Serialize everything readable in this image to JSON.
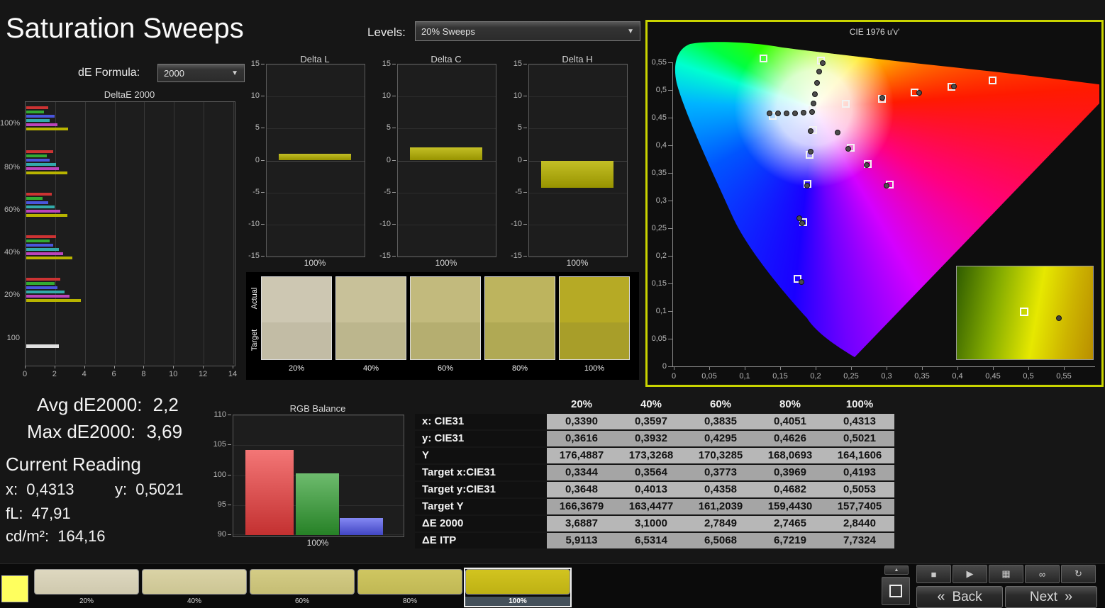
{
  "header": {
    "title": "Saturation Sweeps",
    "levels_label": "Levels:",
    "levels_value": "20% Sweeps",
    "de_formula_label": "dE Formula:",
    "de_formula_value": "2000"
  },
  "accent": {
    "cie_border": "#c9d400"
  },
  "chart_data": [
    {
      "type": "bar",
      "orientation": "horizontal",
      "title": "DeltaE 2000",
      "xlim": [
        0,
        14
      ],
      "xticks": [
        0,
        2,
        4,
        6,
        8,
        10,
        12,
        14
      ],
      "group_colors": [
        "#cc3333",
        "#33aa33",
        "#4a55dd",
        "#33aaaa",
        "#bb44bb",
        "#b8b400"
      ],
      "groups": [
        {
          "label": "100%",
          "values": [
            1.5,
            1.2,
            1.9,
            1.6,
            2.1,
            2.84
          ]
        },
        {
          "label": "80%",
          "values": [
            1.8,
            1.4,
            1.6,
            2.0,
            2.2,
            2.75
          ]
        },
        {
          "label": "60%",
          "values": [
            1.7,
            1.1,
            1.5,
            1.9,
            2.3,
            2.78
          ]
        },
        {
          "label": "40%",
          "values": [
            2.0,
            1.6,
            1.8,
            2.2,
            2.5,
            3.1
          ]
        },
        {
          "label": "20%",
          "values": [
            2.3,
            1.9,
            2.1,
            2.6,
            2.9,
            3.69
          ]
        },
        {
          "label": "100",
          "values": [
            2.2
          ],
          "colors": [
            "#e0e0e0"
          ]
        }
      ]
    },
    {
      "type": "bar",
      "title": "Delta L",
      "ylim": [
        -15,
        15
      ],
      "yticks": [
        15,
        10,
        5,
        0,
        -5,
        -10,
        -15
      ],
      "xlabel": "100%",
      "value": 1.0,
      "bar_color": "#b9b400"
    },
    {
      "type": "bar",
      "title": "Delta C",
      "ylim": [
        -15,
        15
      ],
      "yticks": [
        15,
        10,
        5,
        0,
        -5,
        -10,
        -15
      ],
      "xlabel": "100%",
      "value": 2.0,
      "bar_color": "#b9b400"
    },
    {
      "type": "bar",
      "title": "Delta H",
      "ylim": [
        -15,
        15
      ],
      "yticks": [
        15,
        10,
        5,
        0,
        -5,
        -10,
        -15
      ],
      "xlabel": "100%",
      "value": -4.3,
      "bar_color": "#b9b400"
    },
    {
      "type": "bar",
      "title": "RGB Balance",
      "ylim": [
        90,
        110
      ],
      "yticks": [
        110,
        105,
        100,
        95,
        90
      ],
      "xlabel": "100%",
      "series": [
        {
          "name": "red",
          "value": 104.2,
          "color": "#ee3b3b"
        },
        {
          "name": "green",
          "value": 100.3,
          "color": "#2f9e2f"
        },
        {
          "name": "blue",
          "value": 92.8,
          "color": "#4f55ee"
        }
      ]
    },
    {
      "type": "scatter",
      "title": "CIE 1976 u'v'",
      "xtick_labels": [
        "0",
        "0,05",
        "0,1",
        "0,15",
        "0,2",
        "0,25",
        "0,3",
        "0,35",
        "0,4",
        "0,45",
        "0,5",
        "0,55"
      ],
      "xtick_values": [
        0,
        0.05,
        0.1,
        0.15,
        0.2,
        0.25,
        0.3,
        0.35,
        0.4,
        0.45,
        0.5,
        0.55
      ],
      "ytick_labels": [
        "0,55",
        "0,5",
        "0,45",
        "0,4",
        "0,35",
        "0,3",
        "0,25",
        "0,2",
        "0,15",
        "0,1",
        "0,05",
        "0"
      ],
      "ytick_values": [
        0.55,
        0.5,
        0.45,
        0.4,
        0.35,
        0.3,
        0.25,
        0.2,
        0.15,
        0.1,
        0.05,
        0
      ],
      "targets": [
        [
          0.126,
          0.558
        ],
        [
          0.207,
          0.554
        ],
        [
          0.449,
          0.518
        ],
        [
          0.391,
          0.506
        ],
        [
          0.339,
          0.496
        ],
        [
          0.293,
          0.485
        ],
        [
          0.242,
          0.476
        ],
        [
          0.195,
          0.464
        ],
        [
          0.139,
          0.454
        ],
        [
          0.196,
          0.428
        ],
        [
          0.249,
          0.396
        ],
        [
          0.191,
          0.383
        ],
        [
          0.273,
          0.367
        ],
        [
          0.188,
          0.331
        ],
        [
          0.304,
          0.329
        ],
        [
          0.182,
          0.262
        ],
        [
          0.174,
          0.159
        ]
      ],
      "measurements": [
        [
          0.21,
          0.549
        ],
        [
          0.205,
          0.533
        ],
        [
          0.202,
          0.513
        ],
        [
          0.199,
          0.492
        ],
        [
          0.197,
          0.476
        ],
        [
          0.294,
          0.486
        ],
        [
          0.346,
          0.495
        ],
        [
          0.395,
          0.506
        ],
        [
          0.135,
          0.458
        ],
        [
          0.147,
          0.458
        ],
        [
          0.159,
          0.458
        ],
        [
          0.171,
          0.458
        ],
        [
          0.183,
          0.459
        ],
        [
          0.195,
          0.46
        ],
        [
          0.193,
          0.426
        ],
        [
          0.231,
          0.423
        ],
        [
          0.193,
          0.388
        ],
        [
          0.246,
          0.394
        ],
        [
          0.272,
          0.364
        ],
        [
          0.3,
          0.327
        ],
        [
          0.188,
          0.327
        ],
        [
          0.177,
          0.268
        ],
        [
          0.181,
          0.259
        ],
        [
          0.18,
          0.152
        ]
      ]
    }
  ],
  "swatch_strip": {
    "row_labels": [
      "Actual",
      "Target"
    ],
    "columns": [
      {
        "label": "20%",
        "actual": "#cdc7b2",
        "target": "#c2bca5"
      },
      {
        "label": "40%",
        "actual": "#c8c199",
        "target": "#bcb68d"
      },
      {
        "label": "60%",
        "actual": "#c2ba7d",
        "target": "#b5ae70"
      },
      {
        "label": "80%",
        "actual": "#bdb45e",
        "target": "#b0a954"
      },
      {
        "label": "100%",
        "actual": "#b6aa25",
        "target": "#a89e29"
      }
    ]
  },
  "summary": {
    "avg_label": "Avg dE2000:",
    "avg_value": "2,2",
    "max_label": "Max dE2000:",
    "max_value": "3,69"
  },
  "current_reading": {
    "heading": "Current Reading",
    "x_label": "x:",
    "x_value": "0,4313",
    "y_label": "y:",
    "y_value": "0,5021",
    "fl_label": "fL:",
    "fl_value": "47,91",
    "cd_label": "cd/m²:",
    "cd_value": "164,16"
  },
  "table": {
    "col_headers": [
      "",
      "20%",
      "40%",
      "60%",
      "80%",
      "100%"
    ],
    "rows": [
      {
        "label": "x: CIE31",
        "values": [
          "0,3390",
          "0,3597",
          "0,3835",
          "0,4051",
          "0,4313"
        ]
      },
      {
        "label": "y: CIE31",
        "values": [
          "0,3616",
          "0,3932",
          "0,4295",
          "0,4626",
          "0,5021"
        ]
      },
      {
        "label": "Y",
        "values": [
          "176,4887",
          "173,3268",
          "170,3285",
          "168,0693",
          "164,1606"
        ]
      },
      {
        "label": "Target x:CIE31",
        "values": [
          "0,3344",
          "0,3564",
          "0,3773",
          "0,3969",
          "0,4193"
        ]
      },
      {
        "label": "Target y:CIE31",
        "values": [
          "0,3648",
          "0,4013",
          "0,4358",
          "0,4682",
          "0,5053"
        ]
      },
      {
        "label": "Target Y",
        "values": [
          "166,3679",
          "163,4477",
          "161,2039",
          "159,4430",
          "157,7405"
        ]
      },
      {
        "label": "ΔE 2000",
        "values": [
          "3,6887",
          "3,1000",
          "2,7849",
          "2,7465",
          "2,8440"
        ]
      },
      {
        "label": "ΔE ITP",
        "values": [
          "5,9113",
          "6,5314",
          "6,5068",
          "6,7219",
          "7,7324"
        ]
      }
    ]
  },
  "bottom_bar": {
    "patch_color": "#ffff5e",
    "swatches": [
      {
        "label": "20%",
        "top": "#ded8c0",
        "bottom": "#cfc9ae",
        "active": false
      },
      {
        "label": "40%",
        "top": "#dad3a6",
        "bottom": "#ccc593",
        "active": false
      },
      {
        "label": "60%",
        "top": "#d4cc86",
        "bottom": "#c5bd74",
        "active": false
      },
      {
        "label": "80%",
        "top": "#cfc661",
        "bottom": "#c0b854",
        "active": false
      },
      {
        "label": "100%",
        "top": "#d2c41f",
        "bottom": "#beb114",
        "active": true
      }
    ],
    "transport": [
      {
        "name": "stop",
        "glyph": "■"
      },
      {
        "name": "play",
        "glyph": "▶"
      },
      {
        "name": "pattern",
        "glyph": "▦"
      },
      {
        "name": "loop",
        "glyph": "∞"
      },
      {
        "name": "refresh",
        "glyph": "↻"
      }
    ],
    "eject_glyph": "▲",
    "back_chevron": "«",
    "back_label": "Back",
    "next_label": "Next",
    "next_chevron": "»"
  }
}
